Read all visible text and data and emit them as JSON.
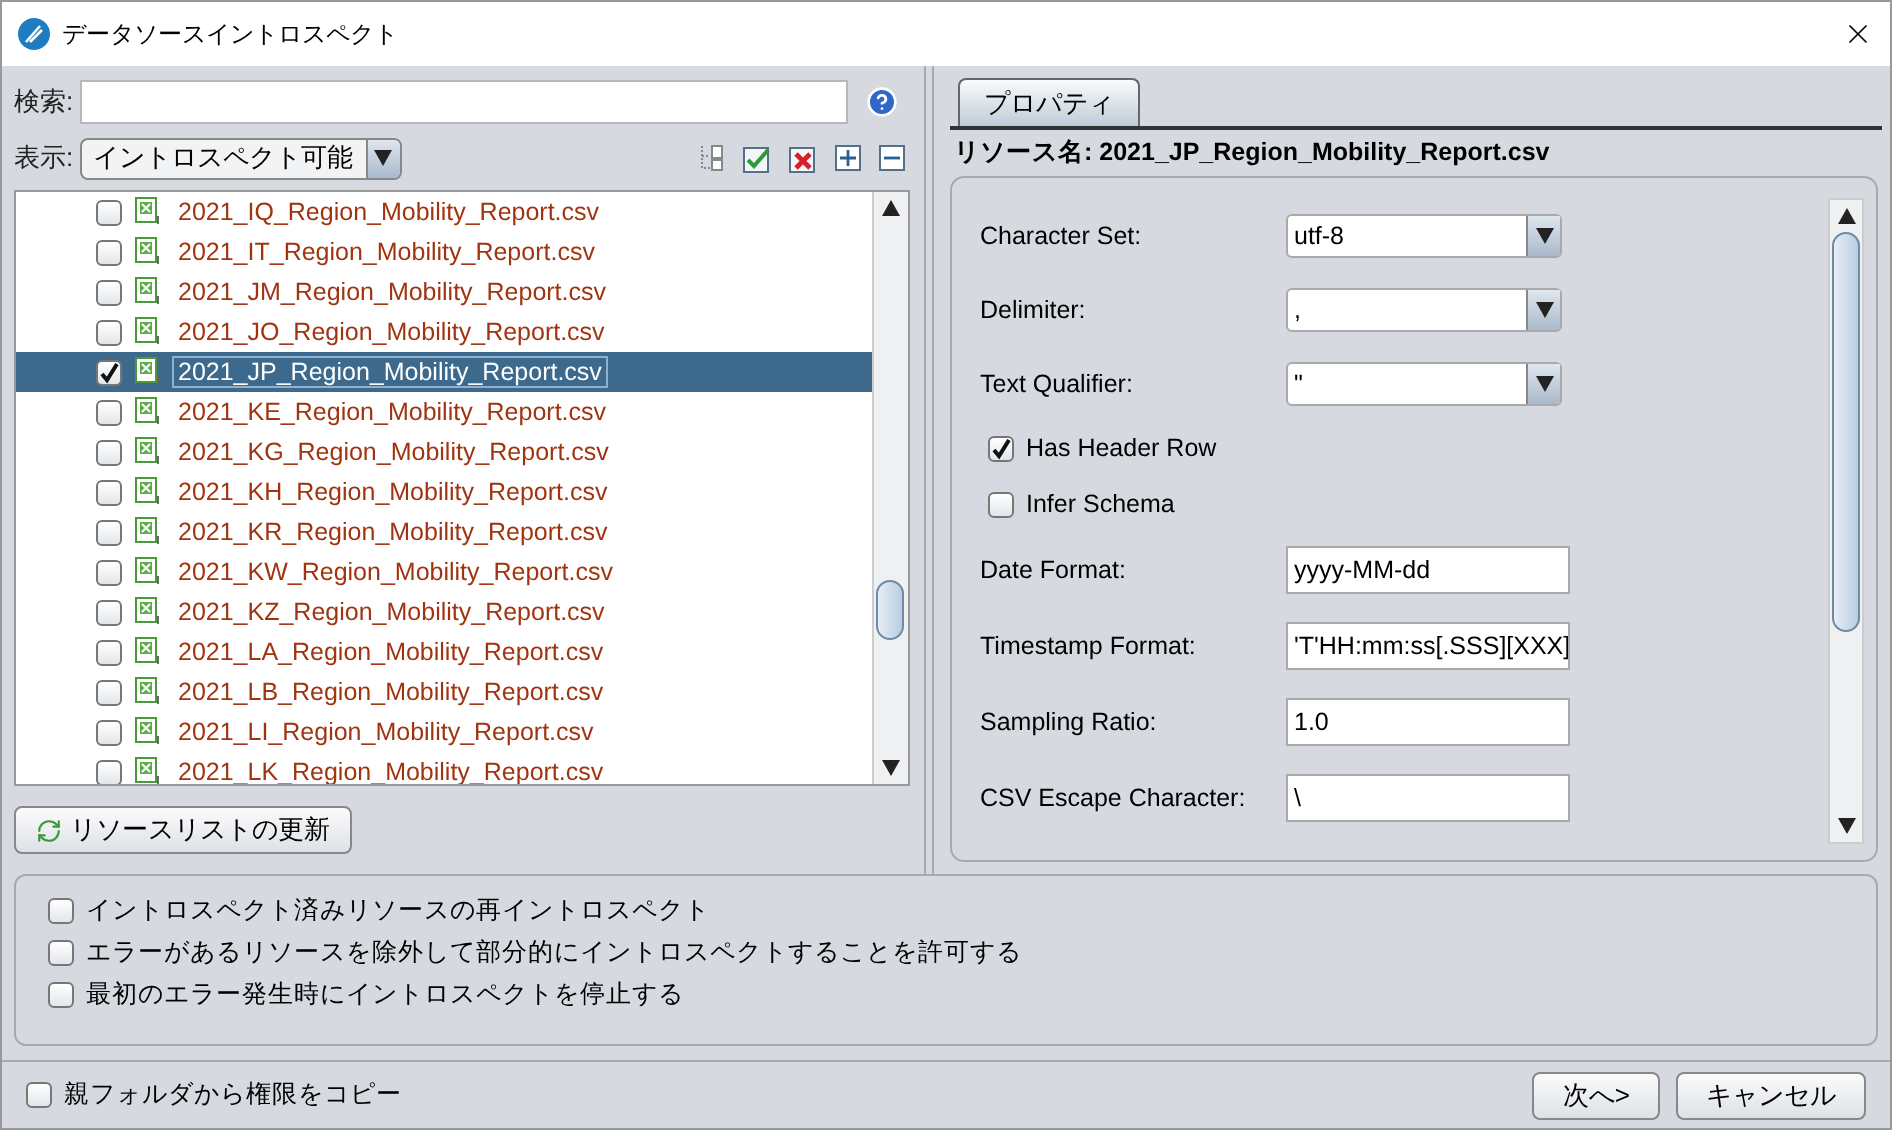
{
  "window": {
    "title": "データソースイントロスペクト"
  },
  "search": {
    "label": "検索:"
  },
  "filter": {
    "label": "表示:",
    "value": "イントロスペクト可能"
  },
  "resources": [
    {
      "name": "2021_IQ_Region_Mobility_Report.csv",
      "checked": false,
      "selected": false
    },
    {
      "name": "2021_IT_Region_Mobility_Report.csv",
      "checked": false,
      "selected": false
    },
    {
      "name": "2021_JM_Region_Mobility_Report.csv",
      "checked": false,
      "selected": false
    },
    {
      "name": "2021_JO_Region_Mobility_Report.csv",
      "checked": false,
      "selected": false
    },
    {
      "name": "2021_JP_Region_Mobility_Report.csv",
      "checked": true,
      "selected": true
    },
    {
      "name": "2021_KE_Region_Mobility_Report.csv",
      "checked": false,
      "selected": false
    },
    {
      "name": "2021_KG_Region_Mobility_Report.csv",
      "checked": false,
      "selected": false
    },
    {
      "name": "2021_KH_Region_Mobility_Report.csv",
      "checked": false,
      "selected": false
    },
    {
      "name": "2021_KR_Region_Mobility_Report.csv",
      "checked": false,
      "selected": false
    },
    {
      "name": "2021_KW_Region_Mobility_Report.csv",
      "checked": false,
      "selected": false
    },
    {
      "name": "2021_KZ_Region_Mobility_Report.csv",
      "checked": false,
      "selected": false
    },
    {
      "name": "2021_LA_Region_Mobility_Report.csv",
      "checked": false,
      "selected": false
    },
    {
      "name": "2021_LB_Region_Mobility_Report.csv",
      "checked": false,
      "selected": false
    },
    {
      "name": "2021_LI_Region_Mobility_Report.csv",
      "checked": false,
      "selected": false
    },
    {
      "name": "2021_LK_Region_Mobility_Report.csv",
      "checked": false,
      "selected": false
    }
  ],
  "refresh_button": "リソースリストの更新",
  "tabs": [
    {
      "label": "プロパティ",
      "selected": true
    }
  ],
  "resource_name": "リソース名: 2021_JP_Region_Mobility_Report.csv",
  "properties": [
    {
      "kind": "select",
      "label": "Character Set:",
      "value": "utf-8"
    },
    {
      "kind": "select",
      "label": "Delimiter:",
      "value": ","
    },
    {
      "kind": "select",
      "label": "Text Qualifier:",
      "value": "\""
    },
    {
      "kind": "checkbox",
      "label": "Has Header Row",
      "checked": true
    },
    {
      "kind": "checkbox",
      "label": "Infer Schema",
      "checked": false
    },
    {
      "kind": "text",
      "label": "Date Format:",
      "value": "yyyy-MM-dd"
    },
    {
      "kind": "text",
      "label": "Timestamp Format:",
      "value": "'T'HH:mm:ss[.SSS][XXX]"
    },
    {
      "kind": "text",
      "label": "Sampling Ratio:",
      "value": "1.0"
    },
    {
      "kind": "text",
      "label": "CSV Escape Character:",
      "value": "\\"
    }
  ],
  "options": [
    {
      "label": "イントロスペクト済みリソースの再イントロスペクト",
      "checked": false
    },
    {
      "label": "エラーがあるリソースを除外して部分的にイントロスペクトすることを許可する",
      "checked": false
    },
    {
      "label": "最初のエラー発生時にイントロスペクトを停止する",
      "checked": false
    }
  ],
  "copy_permissions": {
    "label": "親フォルダから権限をコピー",
    "checked": false
  },
  "buttons": [
    "次へ>",
    "キャンセル"
  ]
}
